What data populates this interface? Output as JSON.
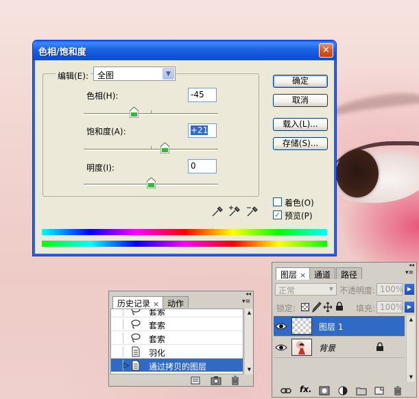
{
  "hue_saturation_dialog": {
    "title": "色相/饱和度",
    "close_glyph": "✕",
    "edit_label": "编辑(E):",
    "edit_value": "全图",
    "hue": {
      "label": "色相(H):",
      "value": "-45",
      "slider_fraction": 0.375
    },
    "saturation": {
      "label": "饱和度(A):",
      "value": "+21",
      "slider_fraction": 0.605
    },
    "lightness": {
      "label": "明度(I):",
      "value": "0",
      "slider_fraction": 0.5
    },
    "buttons": {
      "ok": "确定",
      "cancel": "取消",
      "load": "载入(L)...",
      "save": "存储(S)..."
    },
    "colorize": {
      "label": "着色(O)",
      "checked": false
    },
    "preview": {
      "label": "预览(P)",
      "checked": true,
      "check_glyph": "✓"
    }
  },
  "history_panel": {
    "tabs": [
      {
        "label": "历史记录",
        "close": "×"
      },
      {
        "label": "动作"
      }
    ],
    "menu_glyph": "▾≡",
    "collapse_glyph": "◂◂",
    "items": [
      {
        "label": "套索",
        "icon": "lasso-icon"
      },
      {
        "label": "套索",
        "icon": "lasso-icon"
      },
      {
        "label": "套索",
        "icon": "lasso-icon"
      },
      {
        "label": "羽化",
        "icon": "document-icon"
      },
      {
        "label": "通过拷贝的图层",
        "icon": "document-icon",
        "active": true
      }
    ],
    "current_marker": "▷"
  },
  "layers_panel": {
    "tabs": [
      {
        "label": "图层",
        "close": "×"
      },
      {
        "label": "通道"
      },
      {
        "label": "路径"
      }
    ],
    "menu_glyph": "▾≡",
    "collapse_glyph": "◂◂",
    "blend_mode": "正常",
    "opacity_label": "不透明度:",
    "opacity_value": "100%",
    "lock_label": "锁定:",
    "fill_label": "填充:",
    "fill_value": "100%",
    "layers": [
      {
        "name": "图层 1",
        "active": true
      },
      {
        "name": "背景",
        "locked": true
      }
    ],
    "fx_label": "fx."
  },
  "colors": {
    "titlebar_blue": "#0c53d4",
    "selection_blue": "#316ac5",
    "dialog_face": "#ece9d8",
    "panel_face": "#d4d0c8"
  }
}
